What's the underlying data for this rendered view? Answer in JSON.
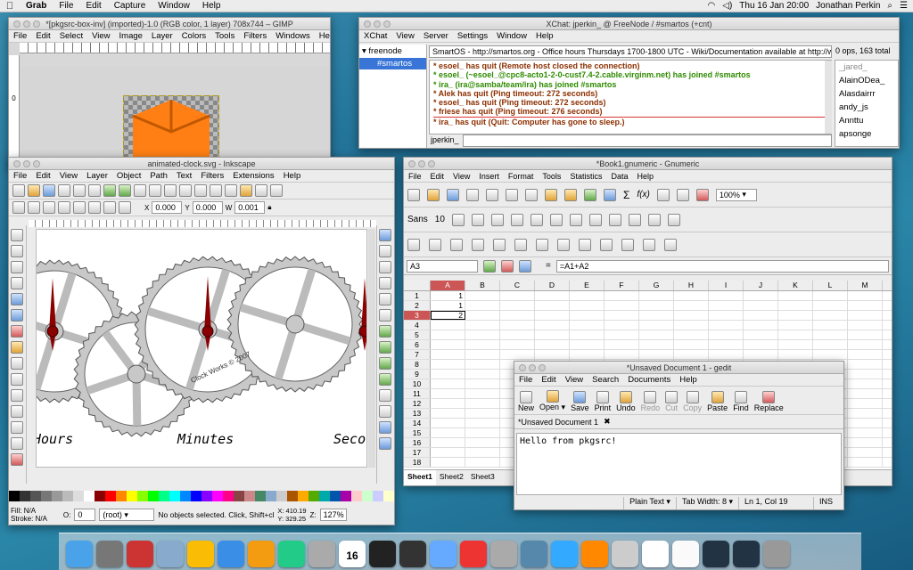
{
  "menubar": {
    "apple": "",
    "app": "Grab",
    "items": [
      "File",
      "Edit",
      "Capture",
      "Window",
      "Help"
    ],
    "clock": "Thu 16 Jan  20:00",
    "user": "Jonathan Perkin"
  },
  "gimp": {
    "title": "*[pkgsrc-box-inv] (imported)-1.0 (RGB color, 1 layer) 708x744 – GIMP",
    "menu": [
      "File",
      "Edit",
      "Select",
      "View",
      "Image",
      "Layer",
      "Colors",
      "Tools",
      "Filters",
      "Windows",
      "Help"
    ],
    "ruler_zero": "0",
    "image_color": "#ff7f14"
  },
  "xchat": {
    "title": "XChat: jperkin_ @ FreeNode / #smartos (+cnt)",
    "menu": [
      "XChat",
      "View",
      "Server",
      "Settings",
      "Window",
      "Help"
    ],
    "tree": [
      "freenode",
      "#smartos"
    ],
    "topic": "SmartOS - http://smartos.org - Office hours Thursdays 1700-1800 UTC - Wiki/Documentation available at http://w",
    "ops": "0 ops, 163 total",
    "messages": [
      {
        "t": "* esoel_ has quit (Remote host closed the connection)",
        "c": "#8b2f00"
      },
      {
        "t": "* esoel_ (~esoel_@cpc8-acto1-2-0-cust7.4-2.cable.virginm.net) has joined #smartos",
        "c": "#2e8b00"
      },
      {
        "t": "* ira_ (ira@samba/team/ira) has joined #smartos",
        "c": "#2e8b00"
      },
      {
        "t": "* Alek has quit (Ping timeout: 272 seconds)",
        "c": "#8b2f00"
      },
      {
        "t": "* esoel_ has quit (Ping timeout: 272 seconds)",
        "c": "#8b2f00"
      },
      {
        "t": "* friese has quit (Ping timeout: 276 seconds)",
        "c": "#8b2f00"
      },
      {
        "t": "* ira_ has quit (Quit: Computer has gone to sleep.)",
        "c": "#8b2f00"
      }
    ],
    "nick": "jperkin_",
    "users": [
      "_jared_",
      "AlainODea_",
      "Alasdairrr",
      "andy_js",
      "Annttu",
      "apsonge"
    ]
  },
  "inkscape": {
    "title": "animated-clock.svg - Inkscape",
    "menu": [
      "File",
      "Edit",
      "View",
      "Layer",
      "Object",
      "Path",
      "Text",
      "Filters",
      "Extensions",
      "Help"
    ],
    "x_label": "X",
    "x_val": "0.000",
    "y_label": "Y",
    "y_val": "0.000",
    "w_label": "W",
    "w_val": "0.001",
    "canvas_words": [
      "Hours",
      "Minutes",
      "Seco"
    ],
    "engraving": "Clock Works © 2007",
    "fill_label": "Fill:",
    "fill_val": "N/A",
    "stroke_label": "Stroke:",
    "stroke_val": "N/A",
    "opacity_label": "O:",
    "opacity_val": "0",
    "layer": "(root)",
    "status": "No objects selected. Click, Shift+cli...",
    "coords": "X: 410.19\nY: 329.25",
    "zoom_label": "Z:",
    "zoom": "127%",
    "palette": [
      "#000",
      "#333",
      "#555",
      "#777",
      "#999",
      "#bbb",
      "#ddd",
      "#fff",
      "#800",
      "#f00",
      "#f80",
      "#ff0",
      "#8f0",
      "#0f0",
      "#0f8",
      "#0ff",
      "#08f",
      "#00f",
      "#80f",
      "#f0f",
      "#f08",
      "#844",
      "#c88",
      "#486",
      "#8ac",
      "#ccc",
      "#a50",
      "#fa0",
      "#5a0",
      "#0aa",
      "#05a",
      "#a0a",
      "#fcc",
      "#cfc",
      "#ccf",
      "#ffc"
    ]
  },
  "gnumeric": {
    "title": "*Book1.gnumeric - Gnumeric",
    "menu": [
      "File",
      "Edit",
      "View",
      "Insert",
      "Format",
      "Tools",
      "Statistics",
      "Data",
      "Help"
    ],
    "font": "Sans",
    "size": "10",
    "zoom": "100%",
    "cell_ref": "A3",
    "formula": "=A1+A2",
    "columns": [
      "A",
      "B",
      "C",
      "D",
      "E",
      "F",
      "G",
      "H",
      "I",
      "J",
      "K",
      "L",
      "M"
    ],
    "cells": [
      "1",
      "1",
      "2"
    ],
    "row_count": 18,
    "sheets": [
      "Sheet1",
      "Sheet2",
      "Sheet3"
    ]
  },
  "gedit": {
    "title": "*Unsaved Document 1 - gedit",
    "menu": [
      "File",
      "Edit",
      "View",
      "Search",
      "Documents",
      "Help"
    ],
    "buttons": [
      "New",
      "Open",
      "Save",
      "Print",
      "Undo",
      "Redo",
      "Cut",
      "Copy",
      "Paste",
      "Find",
      "Replace"
    ],
    "tab": "*Unsaved Document 1",
    "text": "Hello from pkgsrc!",
    "status": [
      "Plain Text ▾",
      "Tab Width: 8 ▾",
      "Ln 1, Col 19",
      "INS"
    ]
  },
  "dock_apps": [
    "finder",
    "launchpad",
    "photo-booth",
    "preview",
    "chrome",
    "itunes",
    "ibooks",
    "facetime",
    "script-editor",
    "calendar",
    "terminal",
    "x11",
    "utilities",
    "tools",
    "system-prefs",
    "migration",
    "safari",
    "vlc",
    "xquartz",
    "vim",
    "documents",
    "screen1",
    "screen2",
    "trash"
  ],
  "dock_badge": "16"
}
